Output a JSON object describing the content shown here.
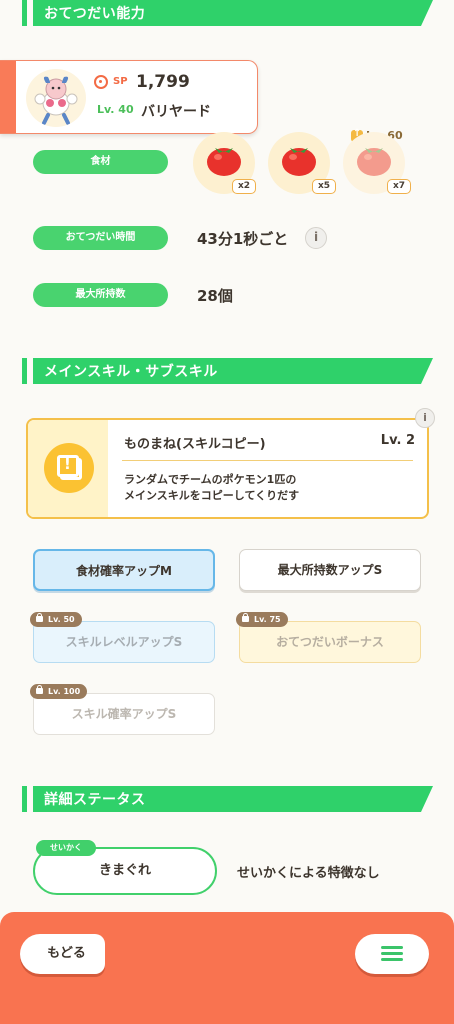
{
  "sections": {
    "helping_ability": "おてつだい能力",
    "main_sub_skill": "メインスキル・サブスキル",
    "detailed_status": "詳細ステータス"
  },
  "pokemon": {
    "sp_label": "SP",
    "sp_value": "1,799",
    "level": "Lv. 40",
    "name": "バリヤード"
  },
  "ingredients": {
    "label": "食材",
    "items": [
      {
        "icon": "tomato-icon",
        "qty": "x2",
        "locked": false
      },
      {
        "icon": "tomato-icon",
        "qty": "x5",
        "locked": false
      },
      {
        "icon": "tomato-icon",
        "qty": "x7",
        "locked": true,
        "unlock_level": "Lv. 60"
      }
    ]
  },
  "help_time": {
    "label": "おてつだい時間",
    "value": "43分1秒ごと"
  },
  "max_carry": {
    "label": "最大所持数",
    "value": "28個"
  },
  "main_skill": {
    "name": "ものまね(スキルコピー)",
    "level": "Lv. 2",
    "description_line1": "ランダムでチームのポケモン1匹の",
    "description_line2": "メインスキルをコピーしてくりだす"
  },
  "sub_skills": [
    {
      "label": "食材確率アップM",
      "style": "blue"
    },
    {
      "label": "最大所持数アップS",
      "style": "white"
    },
    {
      "label": "スキルレベルアップS",
      "style": "blue-faded",
      "lock": "Lv. 50"
    },
    {
      "label": "おてつだいボーナス",
      "style": "yellow-faded",
      "lock": "Lv. 75"
    },
    {
      "label": "スキル確率アップS",
      "style": "white-faded",
      "lock": "Lv. 100"
    }
  ],
  "nature": {
    "tag": "せいかく",
    "value": "きまぐれ",
    "description": "せいかくによる特徴なし"
  },
  "nav": {
    "back_label": "もどる"
  },
  "colors": {
    "accent_green": "#2fd16a",
    "bottom_bar": "#f97350",
    "skill_gold": "#f4c04a",
    "sp_orange": "#f36b45"
  }
}
